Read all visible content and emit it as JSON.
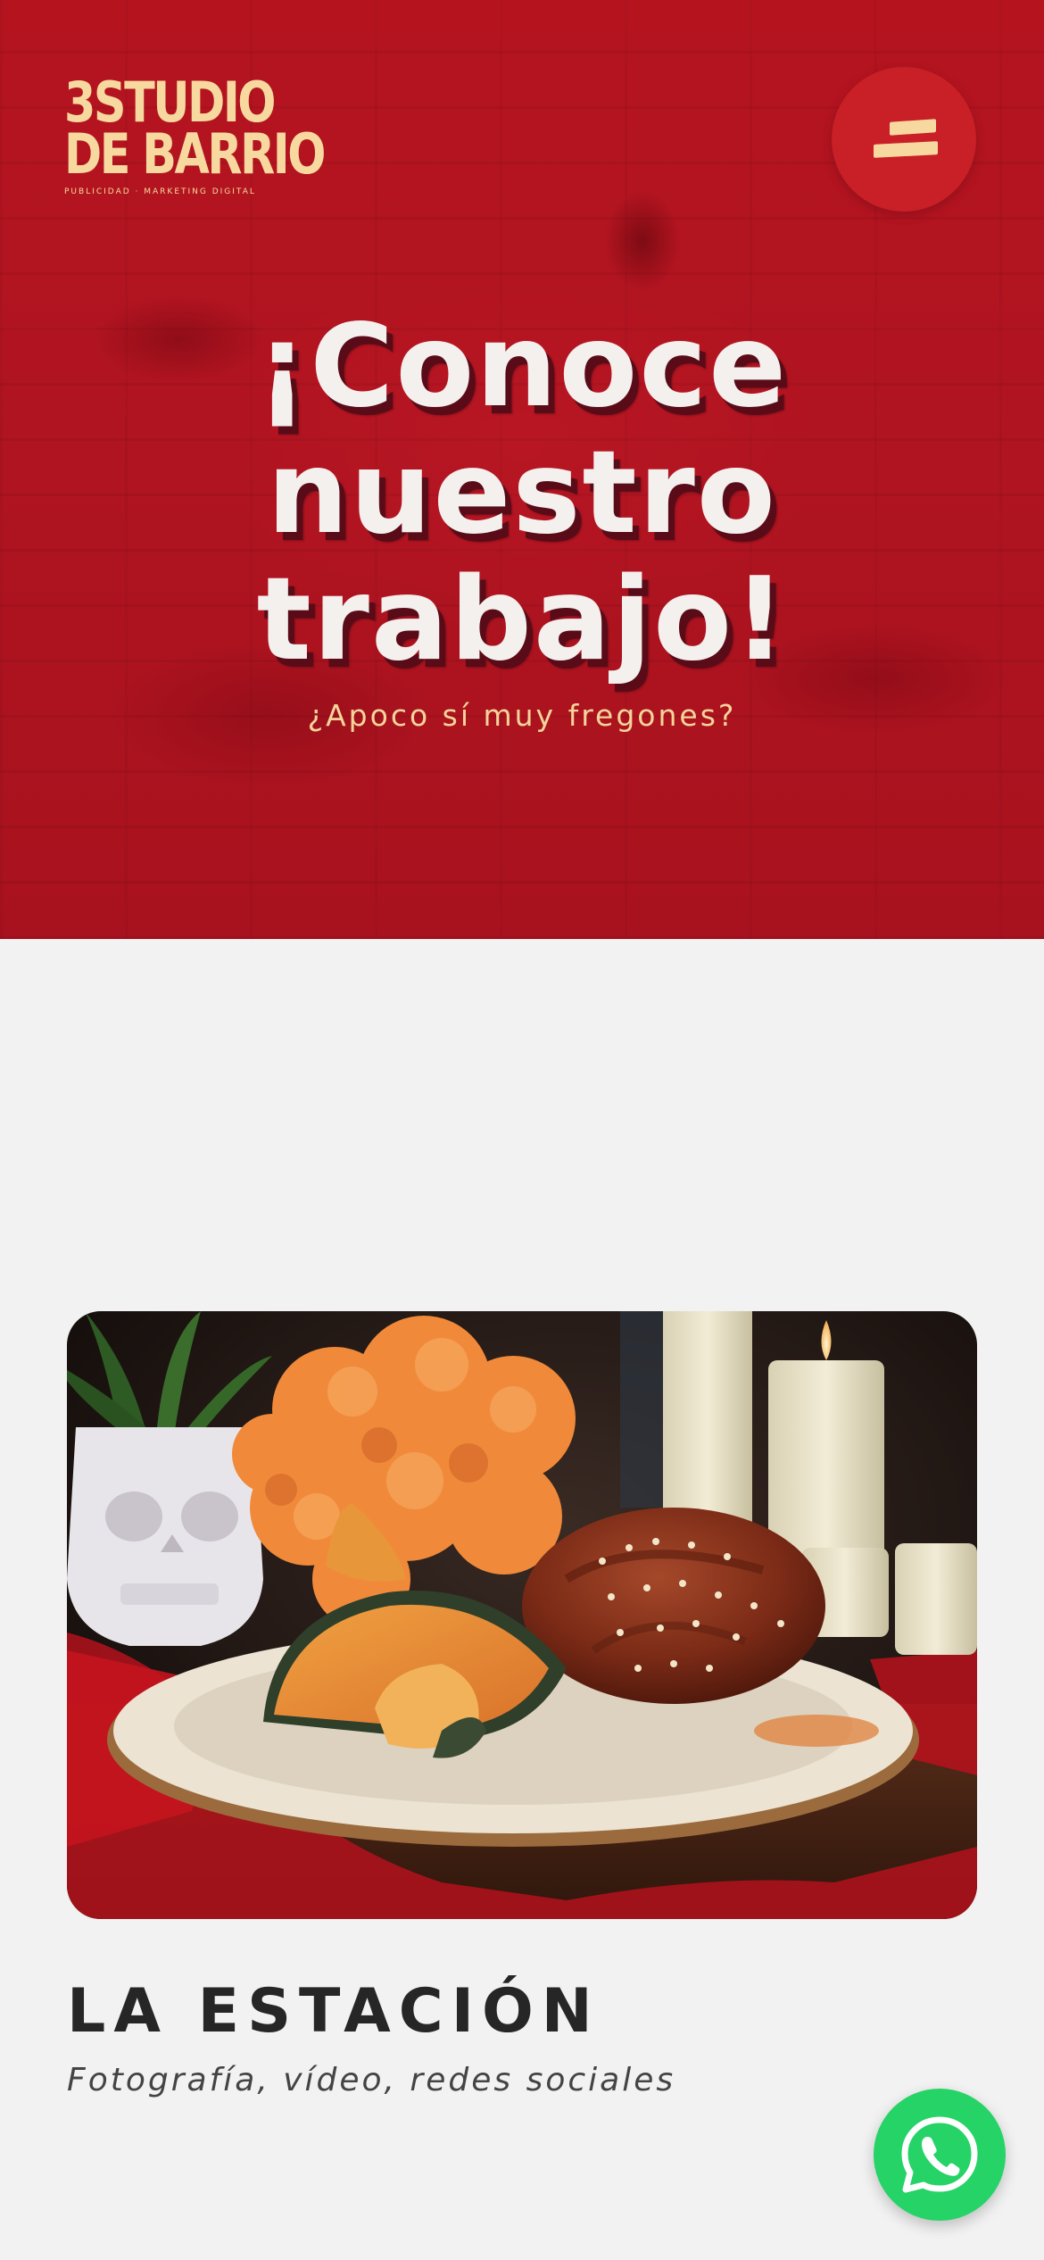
{
  "brand": {
    "logo_line1": "3STUDIO",
    "logo_line2": "DE BARRIO",
    "logo_tagline": "PUBLICIDAD · MARKETING DIGITAL",
    "colors": {
      "hero_red": "#b01420",
      "cream": "#f7d9a0",
      "menu_red": "#c91f27",
      "whatsapp_green": "#25d366",
      "page_background": "#f2f2f2"
    }
  },
  "header": {
    "menu_icon": "hamburger-menu-icon"
  },
  "hero": {
    "title_line1": "¡Conoce",
    "title_line2": "nuestro",
    "title_line3": "trabajo!",
    "subtitle": "¿Apoco sí muy fregones?"
  },
  "project": {
    "image_subject": "pan de muerto with squash on a plate, marigold flowers, candles and skull planter",
    "title": "LA ESTACIÓN",
    "subtitle": "Fotografía, vídeo, redes sociales"
  },
  "floating": {
    "whatsapp_icon": "whatsapp-icon"
  }
}
